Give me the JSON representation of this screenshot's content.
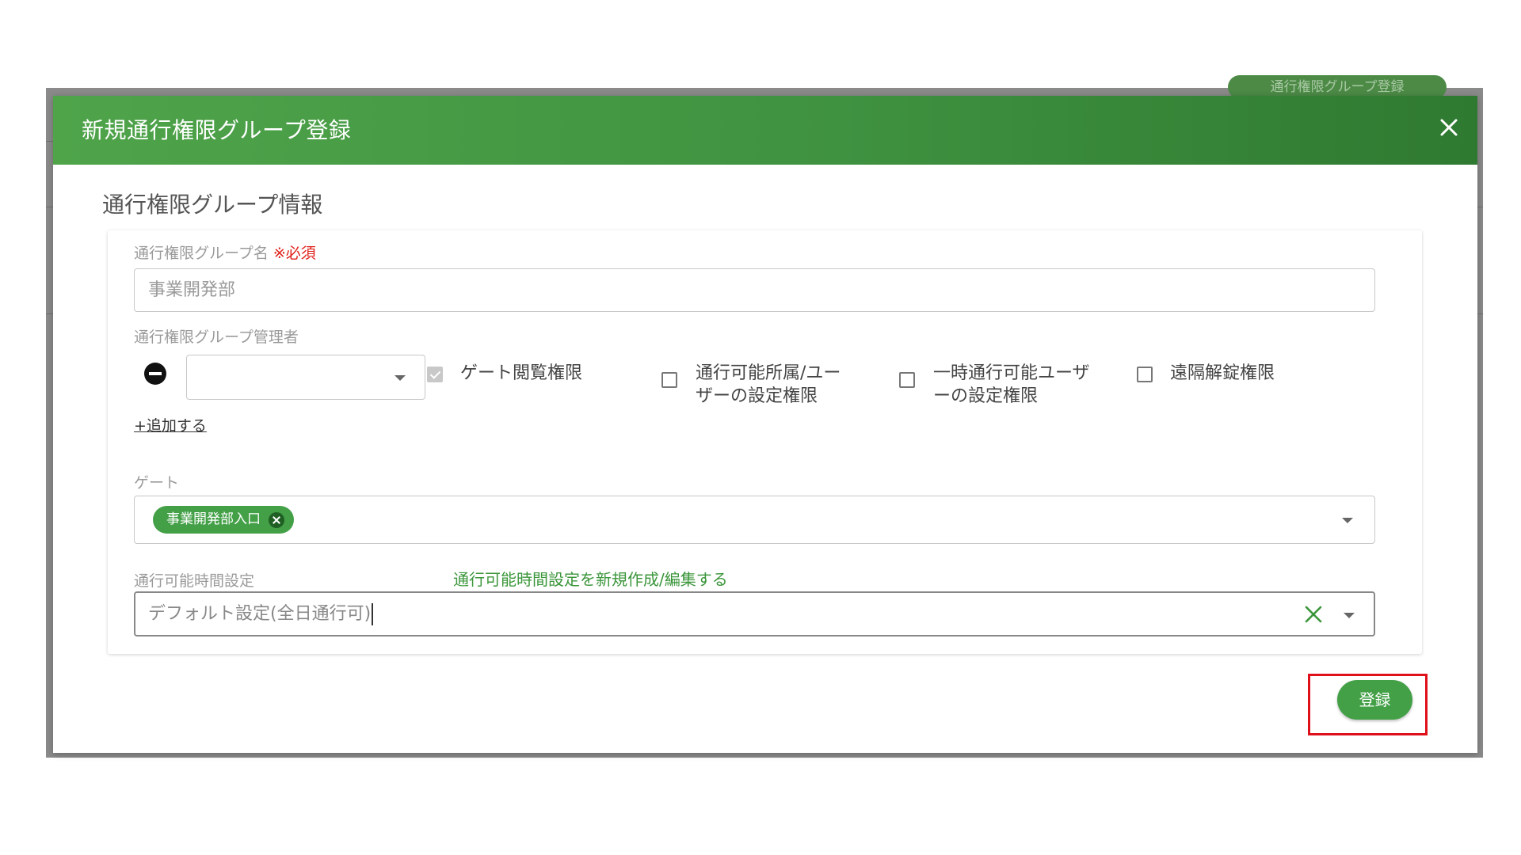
{
  "background_tab": {
    "label": "通行権限グループ登録"
  },
  "modal": {
    "title": "新規通行権限グループ登録",
    "section_title": "通行権限グループ情報"
  },
  "form": {
    "group_name": {
      "label": "通行権限グループ名",
      "required_mark": "※必須",
      "value": "事業開発部"
    },
    "admin": {
      "label": "通行権限グループ管理者",
      "selected_value": "",
      "add_link": "+追加する",
      "permissions": [
        {
          "label": "ゲート閲覧権限",
          "checked": true,
          "disabled": true
        },
        {
          "label": "通行可能所属/ユー\nザーの設定権限",
          "checked": false
        },
        {
          "label": "一時通行可能ユーザ\nーの設定権限",
          "checked": false
        },
        {
          "label": "遠隔解錠権限",
          "checked": false
        }
      ]
    },
    "gate": {
      "label": "ゲート",
      "chips": [
        "事業開発部入口"
      ]
    },
    "time_setting": {
      "label": "通行可能時間設定",
      "link": "通行可能時間設定を新規作成/編集する",
      "value": "デフォルト設定(全日通行可)"
    }
  },
  "submit_label": "登録",
  "colors": {
    "header_green": "#3f9240",
    "accent_green": "#43a047",
    "required_red": "#e0201a",
    "highlight_red": "#e0101a"
  }
}
